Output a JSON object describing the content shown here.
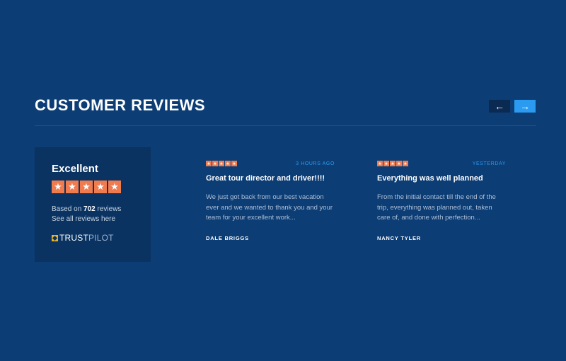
{
  "section": {
    "title": "CUSTOMER REVIEWS"
  },
  "nav": {
    "prev_icon": "arrow-left-icon",
    "prev_glyph": "←",
    "next_icon": "arrow-right-icon",
    "next_glyph": "→"
  },
  "summary": {
    "rating_label": "Excellent",
    "stars": 5,
    "star_glyph": "★",
    "count_prefix": "Based on",
    "count": "702",
    "count_suffix": "reviews",
    "link_text": "See all reviews here",
    "logo_strong": "TRUST",
    "logo_light": "PILOT"
  },
  "reviews": [
    {
      "stars": 5,
      "time": "3 HOURS AGO",
      "title": "Great tour director and driver!!!!",
      "body": "We just got back from our best vacation ever and we wanted to thank you and your team for your excellent work...",
      "author": "DALE BRIGGS"
    },
    {
      "stars": 5,
      "time": "YESTERDAY",
      "title": "Everything was well planned",
      "body": "From the initial contact till the end of the trip, everything was planned out, taken care of, and done with perfection...",
      "author": "NANCY TYLER"
    }
  ],
  "colors": {
    "background": "#0c3d75",
    "card": "#0a3361",
    "accent": "#2a9bf0",
    "star": "#f07b4f"
  }
}
